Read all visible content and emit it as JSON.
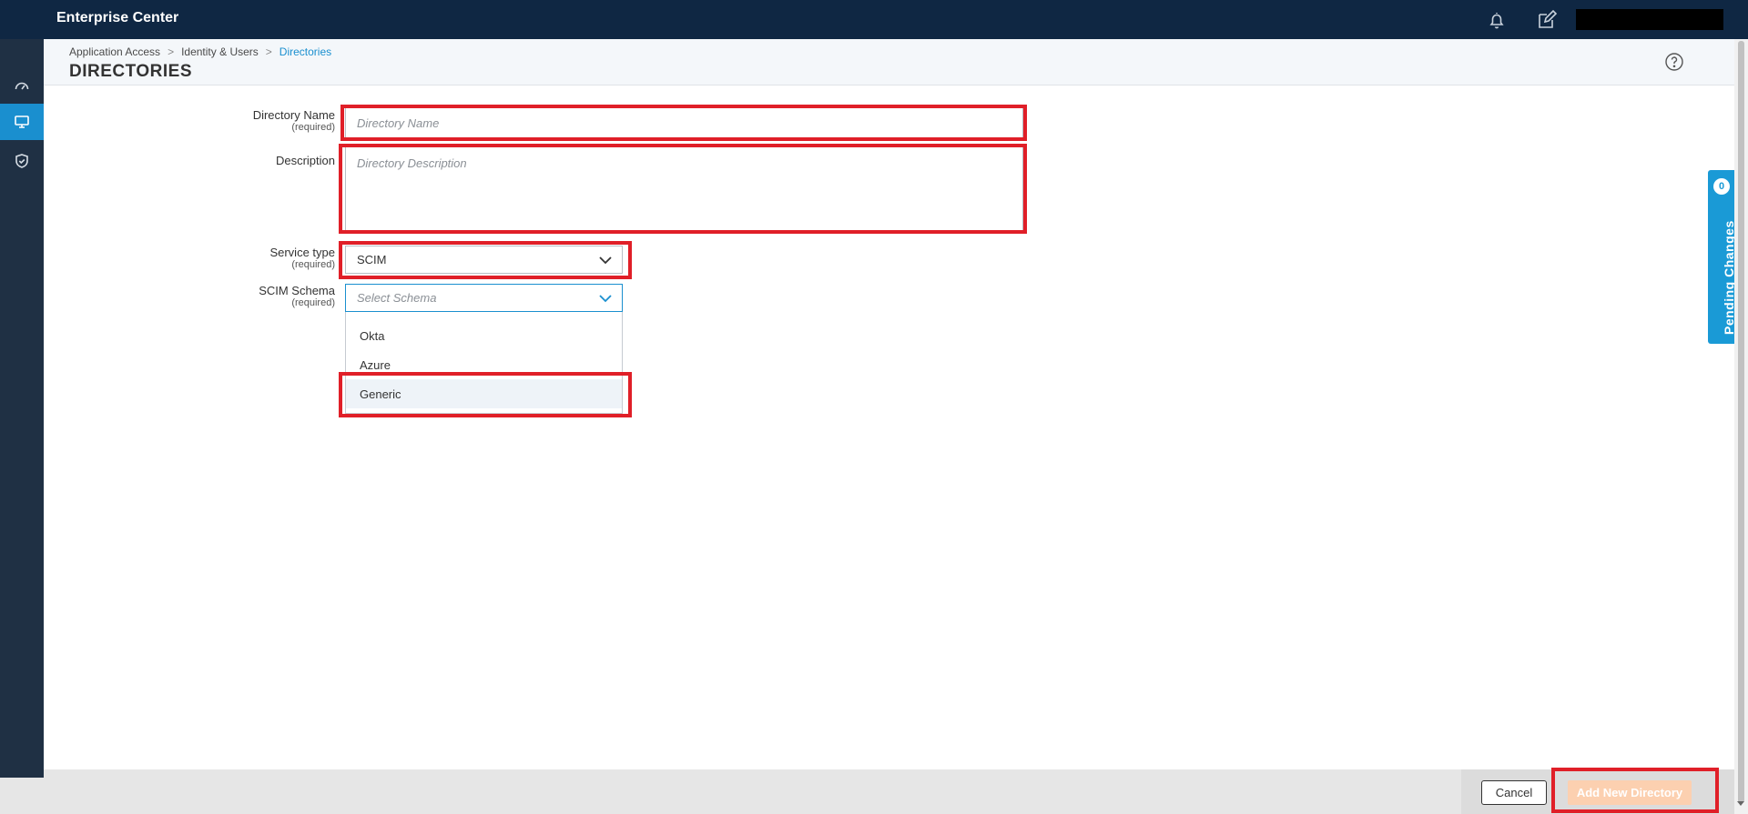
{
  "app": {
    "title": "Enterprise Center"
  },
  "header": {
    "breadcrumb": [
      "Application Access",
      "Identity & Users",
      "Directories"
    ],
    "breadcrumb_sep": ">",
    "page_title": "DIRECTORIES"
  },
  "form": {
    "directory_name": {
      "label": "Directory Name",
      "required": "(required)",
      "placeholder": "Directory Name",
      "value": ""
    },
    "description": {
      "label": "Description",
      "placeholder": "Directory Description",
      "value": ""
    },
    "service_type": {
      "label": "Service type",
      "required": "(required)",
      "value": "SCIM"
    },
    "scim_schema": {
      "label": "SCIM Schema",
      "required": "(required)",
      "placeholder": "Select Schema",
      "options": [
        "Okta",
        "Azure",
        "Generic"
      ],
      "hovered_option": "Generic"
    }
  },
  "pending_changes": {
    "label": "Pending Changes",
    "count": "0"
  },
  "footer": {
    "cancel_label": "Cancel",
    "add_label": "Add New Directory"
  },
  "icons": {
    "topbar": [
      "bell-icon",
      "edit-icon"
    ],
    "nav": [
      "dashboard-icon",
      "monitor-icon",
      "shield-check-icon"
    ],
    "help": "help-icon"
  },
  "colors": {
    "topbar": "#0f2743",
    "leftnav": "#1f3044",
    "accent": "#1a8fcf",
    "highlight": "#e01f28",
    "add_button": "#fcd0b0"
  }
}
